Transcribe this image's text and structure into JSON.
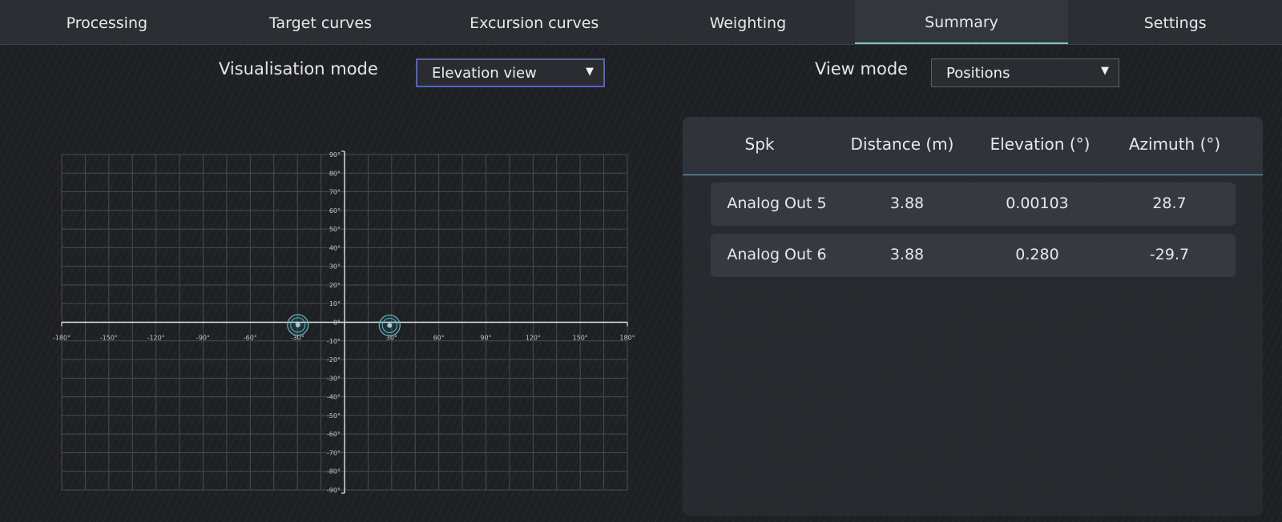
{
  "tabs": [
    {
      "label": "Processing",
      "active": false
    },
    {
      "label": "Target curves",
      "active": false
    },
    {
      "label": "Excursion curves",
      "active": false
    },
    {
      "label": "Weighting",
      "active": false
    },
    {
      "label": "Summary",
      "active": true
    },
    {
      "label": "Settings",
      "active": false
    }
  ],
  "controls": {
    "visualisation_label": "Visualisation mode",
    "visualisation_value": "Elevation view",
    "view_mode_label": "View mode",
    "view_mode_value": "Positions",
    "arrow": "▼"
  },
  "table": {
    "headers": [
      "Spk",
      "Distance (m)",
      "Elevation (°)",
      "Azimuth (°)"
    ],
    "rows": [
      [
        "Analog Out 5",
        "3.88",
        "0.00103",
        "28.7"
      ],
      [
        "Analog Out 6",
        "3.88",
        "0.280",
        "-29.7"
      ]
    ]
  },
  "chart_data": {
    "type": "scatter",
    "x_ticks": [
      "-180°",
      "-150°",
      "-120°",
      "-90°",
      "-60°",
      "-30°",
      "30°",
      "60°",
      "90°",
      "120°",
      "150°",
      "180°"
    ],
    "y_ticks": [
      "90°",
      "80°",
      "70°",
      "60°",
      "50°",
      "40°",
      "30°",
      "20°",
      "10°",
      "0°",
      "-10°",
      "-20°",
      "-30°",
      "-40°",
      "-50°",
      "-60°",
      "-70°",
      "-80°",
      "-90°"
    ],
    "xlim": [
      -180,
      180
    ],
    "ylim": [
      -90,
      90
    ],
    "grid": true,
    "points": [
      {
        "x": -29.7,
        "y": 0.28
      },
      {
        "x": 28.7,
        "y": 0.00103
      }
    ],
    "point_color": "#7fd3e0",
    "ring_color": "#5fb4c3"
  }
}
